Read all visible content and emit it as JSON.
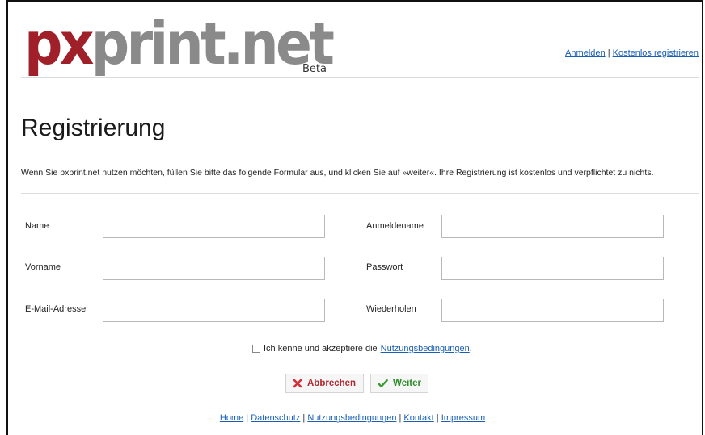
{
  "header": {
    "logo_px": "px",
    "logo_rest": "print.net",
    "beta": "Beta",
    "login_link": "Anmelden",
    "register_link": "Kostenlos registrieren",
    "separator": "|"
  },
  "main": {
    "title": "Registrierung",
    "intro": "Wenn Sie pxprint.net nutzen möchten, füllen Sie bitte das folgende Formular aus, und klicken Sie auf »weiter«. Ihre Registrierung ist kostenlos und verpflichtet zu nichts."
  },
  "form": {
    "name_label": "Name",
    "name_value": "",
    "firstname_label": "Vorname",
    "firstname_value": "",
    "email_label": "E-Mail-Adresse",
    "email_value": "",
    "username_label": "Anmeldename",
    "username_value": "",
    "password_label": "Passwort",
    "password_value": "",
    "repeat_label": "Wiederholen",
    "repeat_value": "",
    "terms_text": "Ich kenne und akzeptiere die",
    "terms_link": "Nutzungsbedingungen",
    "terms_suffix": ".",
    "terms_checked": false,
    "cancel_label": "Abbrechen",
    "next_label": "Weiter"
  },
  "footer": {
    "links": [
      "Home",
      "Datenschutz",
      "Nutzungsbedingungen",
      "Kontakt",
      "Impressum"
    ],
    "separator": "|"
  },
  "colors": {
    "logo_red": "#a0202a",
    "logo_gray": "#8a8a8a",
    "link": "#1a5fb4",
    "cancel": "#b3262e",
    "next": "#2f8a2a"
  }
}
